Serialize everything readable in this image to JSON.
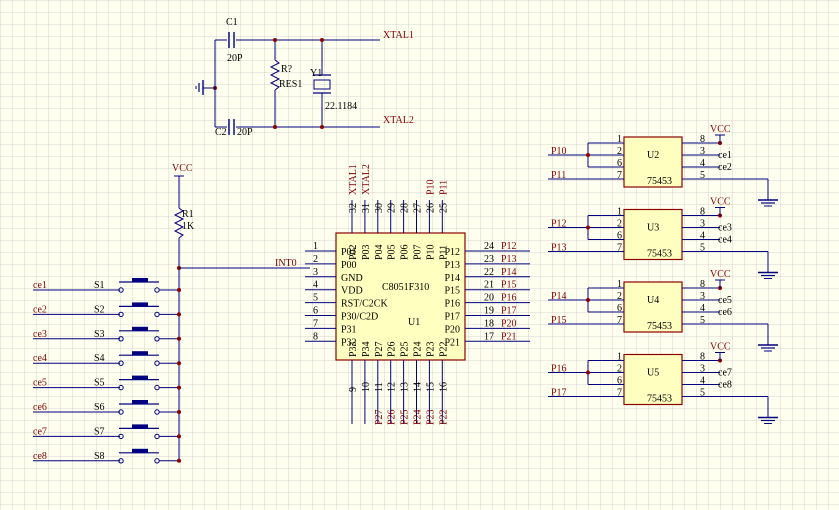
{
  "colors": {
    "background": "#fffff0",
    "grid": "#c8c8c8",
    "wire": "#000080",
    "net_label": "#800000",
    "part_body": "#ffffc0",
    "part_outline": "#8b0000",
    "text": "#000000",
    "pin_number": "#000000",
    "junction": "#8b0000"
  },
  "oscillator": {
    "c1": {
      "ref": "C1",
      "value": "20P"
    },
    "c2": {
      "ref": "C2",
      "value": "20P"
    },
    "res": {
      "ref": "R?",
      "name": "RES1"
    },
    "crystal": {
      "ref": "Y1",
      "value": "22.1184"
    },
    "xtal1": "XTAL1",
    "xtal2": "XTAL2"
  },
  "reset_resistor": {
    "ref": "R1",
    "value": "1K",
    "supply": "VCC",
    "net": "INT0"
  },
  "switches": [
    {
      "ref": "S1",
      "net": "ce1"
    },
    {
      "ref": "S2",
      "net": "ce2"
    },
    {
      "ref": "S3",
      "net": "ce3"
    },
    {
      "ref": "S4",
      "net": "ce4"
    },
    {
      "ref": "S5",
      "net": "ce5"
    },
    {
      "ref": "S6",
      "net": "ce6"
    },
    {
      "ref": "S7",
      "net": "ce7"
    },
    {
      "ref": "S8",
      "net": "ce8"
    }
  ],
  "mcu": {
    "ref": "U1",
    "part": "C8051F310",
    "left_pins": [
      {
        "num": "1",
        "name": "P01",
        "net": ""
      },
      {
        "num": "2",
        "name": "P00",
        "net": "INT0"
      },
      {
        "num": "3",
        "name": "GND",
        "net": ""
      },
      {
        "num": "4",
        "name": "VDD",
        "net": ""
      },
      {
        "num": "5",
        "name": "RST/C2CK",
        "net": ""
      },
      {
        "num": "6",
        "name": "P30/C2D",
        "net": ""
      },
      {
        "num": "7",
        "name": "P31",
        "net": ""
      },
      {
        "num": "8",
        "name": "P32",
        "net": ""
      }
    ],
    "right_pins": [
      {
        "num": "24",
        "name": "P12",
        "net": "P12"
      },
      {
        "num": "23",
        "name": "P13",
        "net": "P13"
      },
      {
        "num": "22",
        "name": "P14",
        "net": "P14"
      },
      {
        "num": "21",
        "name": "P15",
        "net": "P15"
      },
      {
        "num": "20",
        "name": "P16",
        "net": "P16"
      },
      {
        "num": "19",
        "name": "P17",
        "net": "P17"
      },
      {
        "num": "18",
        "name": "P20",
        "net": "P20"
      },
      {
        "num": "17",
        "name": "P21",
        "net": "P21"
      }
    ],
    "top_pins": [
      {
        "num": "32",
        "name": "P02",
        "net": "XTAL1"
      },
      {
        "num": "31",
        "name": "P03",
        "net": "XTAL2"
      },
      {
        "num": "30",
        "name": "P04",
        "net": ""
      },
      {
        "num": "29",
        "name": "P05",
        "net": ""
      },
      {
        "num": "28",
        "name": "P06",
        "net": ""
      },
      {
        "num": "27",
        "name": "P07",
        "net": ""
      },
      {
        "num": "26",
        "name": "P10",
        "net": "P10"
      },
      {
        "num": "25",
        "name": "P11",
        "net": "P11"
      }
    ],
    "bottom_pins": [
      {
        "num": "9",
        "name": "P33",
        "net": ""
      },
      {
        "num": "10",
        "name": "P34",
        "net": ""
      },
      {
        "num": "11",
        "name": "P27",
        "net": "P27"
      },
      {
        "num": "12",
        "name": "P26",
        "net": "P26"
      },
      {
        "num": "13",
        "name": "P25",
        "net": "P25"
      },
      {
        "num": "14",
        "name": "P24",
        "net": "P24"
      },
      {
        "num": "15",
        "name": "P23",
        "net": "P23"
      },
      {
        "num": "16",
        "name": "P22",
        "net": "P22"
      }
    ]
  },
  "drivers": [
    {
      "ref": "U2",
      "part": "75453",
      "in_a": "P10",
      "in_b": "P11",
      "out_a": "ce1",
      "out_b": "ce2",
      "supply": "VCC",
      "pins": {
        "p1": "1",
        "p2": "2",
        "p6": "6",
        "p7": "7",
        "p8": "8",
        "p3": "3",
        "p4": "4",
        "p5": "5"
      }
    },
    {
      "ref": "U3",
      "part": "75453",
      "in_a": "P12",
      "in_b": "P13",
      "out_a": "ce3",
      "out_b": "ce4",
      "supply": "VCC",
      "pins": {
        "p1": "1",
        "p2": "2",
        "p6": "6",
        "p7": "7",
        "p8": "8",
        "p3": "3",
        "p4": "4",
        "p5": "5"
      }
    },
    {
      "ref": "U4",
      "part": "75453",
      "in_a": "P14",
      "in_b": "P15",
      "out_a": "ce5",
      "out_b": "ce6",
      "supply": "VCC",
      "pins": {
        "p1": "1",
        "p2": "2",
        "p6": "6",
        "p7": "7",
        "p8": "8",
        "p3": "3",
        "p4": "4",
        "p5": "5"
      }
    },
    {
      "ref": "U5",
      "part": "75453",
      "in_a": "P16",
      "in_b": "P17",
      "out_a": "ce7",
      "out_b": "ce8",
      "supply": "VCC",
      "pins": {
        "p1": "1",
        "p2": "2",
        "p6": "6",
        "p7": "7",
        "p8": "8",
        "p3": "3",
        "p4": "4",
        "p5": "5"
      }
    }
  ]
}
